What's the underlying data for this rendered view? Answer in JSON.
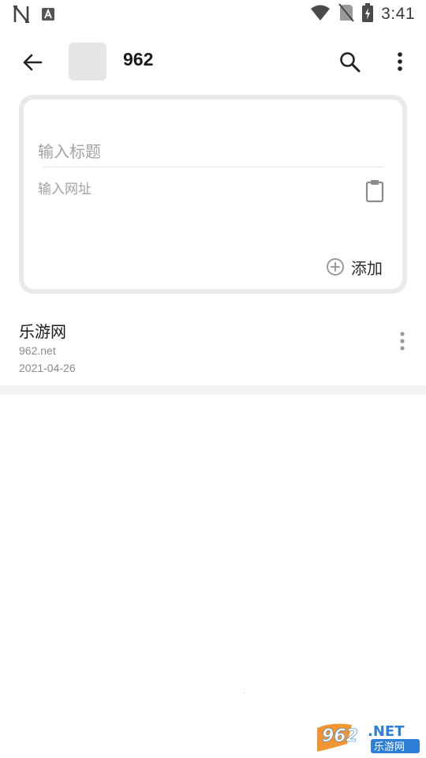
{
  "status_bar": {
    "time": "3:41",
    "notification_icons": [
      "n-app-icon",
      "text-a-icon"
    ],
    "system_icons": [
      "wifi-icon",
      "no-sim-icon",
      "battery-charging-icon"
    ]
  },
  "app_bar": {
    "title": "962",
    "back_icon": "arrow-left-icon",
    "search_icon": "search-icon",
    "more_icon": "more-vert-icon"
  },
  "add_form": {
    "title_placeholder": "输入标题",
    "url_placeholder": "输入网址",
    "add_label": "添加"
  },
  "bookmarks": [
    {
      "title": "乐游网",
      "url": "962.net",
      "date": "2021-04-26"
    }
  ],
  "colors": {
    "card_border": "#e9e9e9",
    "placeholder": "#a2a2a2",
    "secondary_text": "#8a8a8a",
    "watermark_orange": "#f08a1c",
    "watermark_blue": "#2d7fd8"
  }
}
